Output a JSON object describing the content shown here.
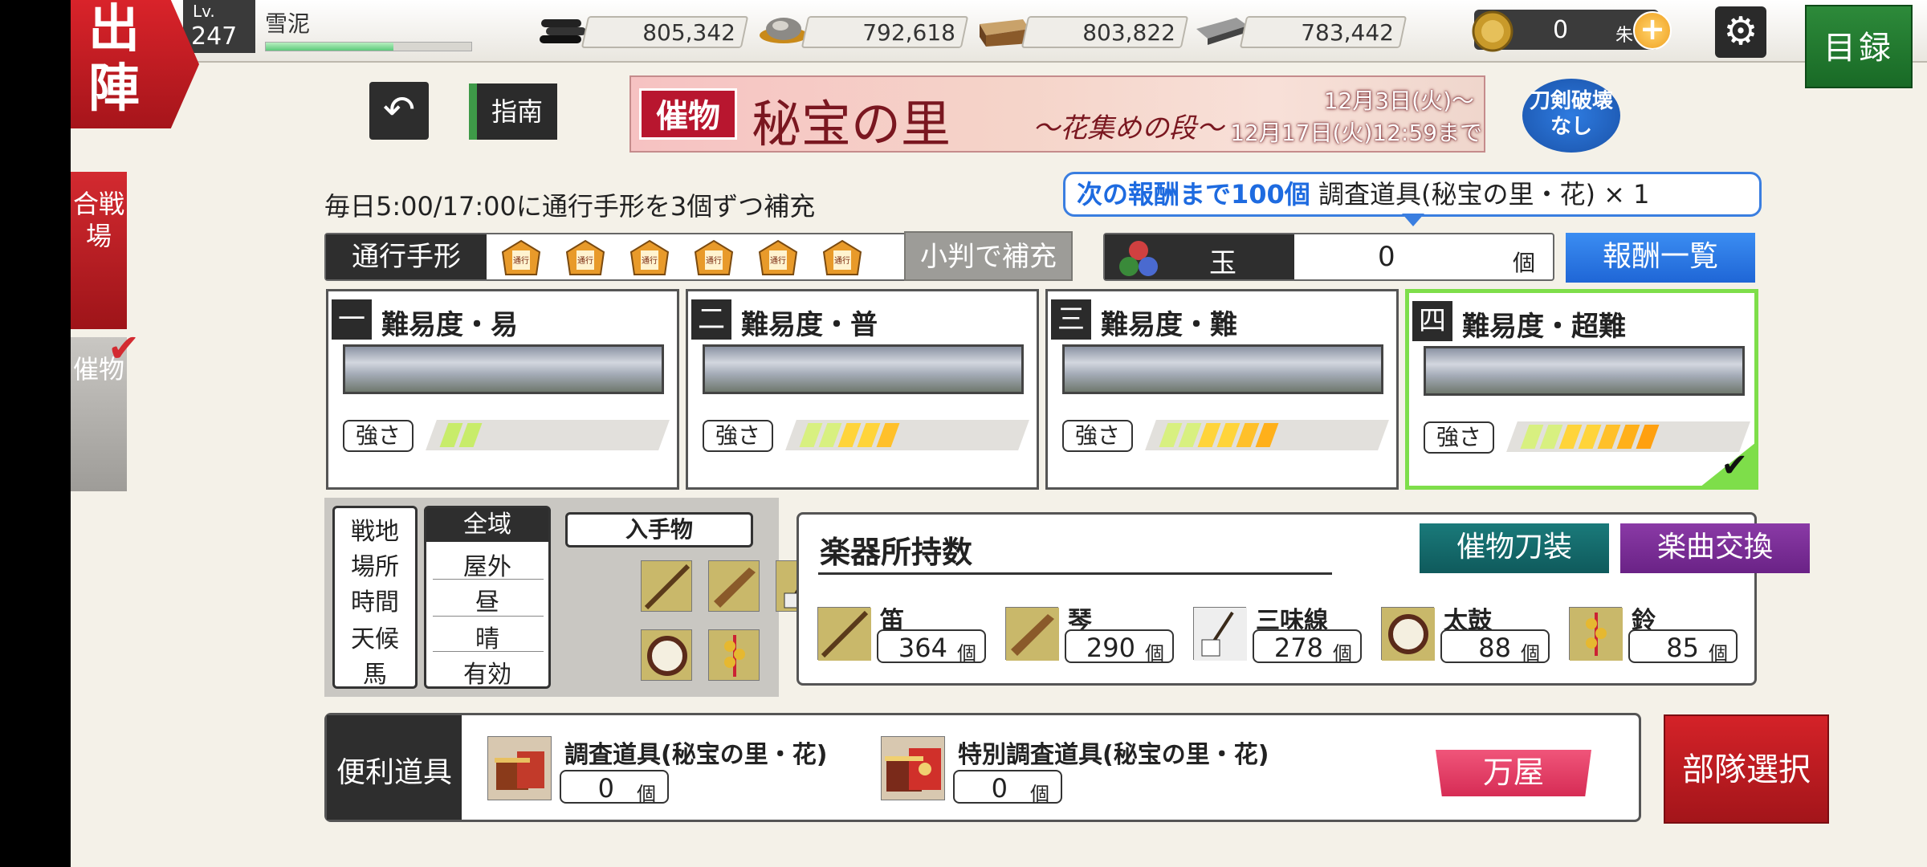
{
  "header": {
    "sortie_label": "出陣",
    "level_label": "Lv.",
    "level": "247",
    "player_name": "雪泥",
    "xp_fraction": 0.62,
    "resources": [
      {
        "name": "charcoal",
        "icon": "charcoal-icon",
        "value": "805,342"
      },
      {
        "name": "steel",
        "icon": "steel-icon",
        "value": "792,618"
      },
      {
        "name": "coolant",
        "icon": "coolant-icon",
        "value": "803,822"
      },
      {
        "name": "whetstone",
        "icon": "whetstone-icon",
        "value": "783,442"
      }
    ],
    "koban": {
      "icon": "koban-coin-icon",
      "value": "0",
      "unit": "朱",
      "plus": "+"
    },
    "settings_icon": "gear-icon",
    "catalog_label": "目録"
  },
  "side_tabs": {
    "battlefield": "合戦場",
    "event": "催物",
    "event_checked": true
  },
  "toolbar": {
    "back_icon": "undo-arrow-icon",
    "guide_label": "指南"
  },
  "banner": {
    "tag": "催物",
    "title": "秘宝の里",
    "subtitle": "〜花集めの段〜",
    "date_start": "12月3日(火)〜",
    "date_end": "12月17日(火)12:59まで"
  },
  "no_break_badge": {
    "line1": "刀剣破壊",
    "line2": "なし"
  },
  "refill_note": "毎日5:00/17:00に通行手形を3個ずつ補充",
  "next_reward": {
    "prefix": "次の報酬まで100個",
    "item": "調査道具(秘宝の里・花) × 1"
  },
  "passes": {
    "label": "通行手形",
    "count": 6,
    "ticket_text": "通行",
    "refill_button": "小判で補充"
  },
  "orbs": {
    "label": "玉",
    "value": "0",
    "unit": "個"
  },
  "reward_list_button": "報酬一覧",
  "difficulties": [
    {
      "num": "一",
      "title": "難易度・易",
      "strength_label": "強さ",
      "strength": 2,
      "selected": false
    },
    {
      "num": "二",
      "title": "難易度・普",
      "strength_label": "強さ",
      "strength": 5,
      "selected": false
    },
    {
      "num": "三",
      "title": "難易度・難",
      "strength_label": "強さ",
      "strength": 6,
      "selected": false
    },
    {
      "num": "四",
      "title": "難易度・超難",
      "strength_label": "強さ",
      "strength": 7,
      "selected": true
    }
  ],
  "battlefield": {
    "keys": [
      "戦地",
      "場所",
      "時間",
      "天候",
      "馬"
    ],
    "values": [
      "全域",
      "屋外",
      "昼",
      "晴",
      "有効"
    ],
    "loot_label": "入手物",
    "loot_icons": [
      "flute-icon",
      "koto-icon",
      "shamisen-icon",
      "taiko-icon",
      "suzu-bell-icon"
    ]
  },
  "instruments": {
    "title": "楽器所持数",
    "event_sword_button": "催物刀装",
    "song_exchange_button": "楽曲交換",
    "items": [
      {
        "name": "笛",
        "count": "364",
        "unit": "個",
        "icon": "flute-icon"
      },
      {
        "name": "琴",
        "count": "290",
        "unit": "個",
        "icon": "koto-icon"
      },
      {
        "name": "三味線",
        "count": "278",
        "unit": "個",
        "icon": "shamisen-icon"
      },
      {
        "name": "太鼓",
        "count": "88",
        "unit": "個",
        "icon": "taiko-icon"
      },
      {
        "name": "鈴",
        "count": "85",
        "unit": "個",
        "icon": "suzu-bell-icon"
      }
    ]
  },
  "tools": {
    "label": "便利道具",
    "items": [
      {
        "name": "調査道具(秘宝の里・花)",
        "count": "0",
        "unit": "個",
        "icon": "survey-tool-icon"
      },
      {
        "name": "特別調査道具(秘宝の里・花)",
        "count": "0",
        "unit": "個",
        "icon": "special-survey-tool-icon"
      }
    ],
    "shop_button": "万屋"
  },
  "unit_select_button": "部隊選択",
  "colors": {
    "accent_red": "#d32a30",
    "accent_blue": "#1f66d6",
    "selected_green": "#7ede4a",
    "teal": "#0f5a5c",
    "purple": "#6a2286",
    "shop_pink": "#d62c55"
  }
}
